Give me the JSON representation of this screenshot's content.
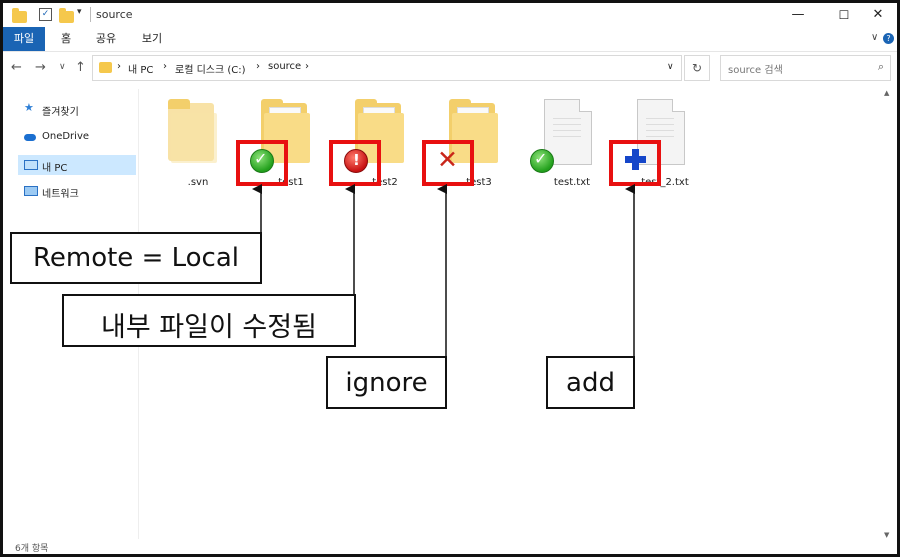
{
  "window": {
    "title": "source",
    "controls": {
      "minimize": "—",
      "maximize": "☐",
      "close": "✕"
    },
    "quick_access_icons": [
      "folder-icon",
      "checkbox-icon",
      "folder-icon",
      "dropdown-arrow-icon"
    ]
  },
  "ribbon": {
    "tabs": [
      {
        "label": "파일",
        "active": true
      },
      {
        "label": "홈",
        "active": false
      },
      {
        "label": "공유",
        "active": false
      },
      {
        "label": "보기",
        "active": false
      }
    ],
    "collapse_glyph": "∨",
    "help_glyph": "?"
  },
  "navigation": {
    "back": "←",
    "forward": "→",
    "recent": "∨",
    "up": "↑",
    "breadcrumb": [
      "내 PC",
      "로컬 디스크 (C:)",
      "source"
    ],
    "separator": "›",
    "dropdown": "∨",
    "refresh": "↻",
    "search_placeholder": "source 검색",
    "search_glyph": "⌕"
  },
  "sidebar": {
    "items": [
      {
        "label": "즐겨찾기",
        "icon": "star-icon",
        "selected": false
      },
      {
        "label": "OneDrive",
        "icon": "cloud-icon",
        "selected": false
      },
      {
        "label": "내 PC",
        "icon": "computer-icon",
        "selected": true
      },
      {
        "label": "네트워크",
        "icon": "network-icon",
        "selected": false
      }
    ]
  },
  "files": [
    {
      "name": ".svn",
      "type": "folder",
      "overlay": "none"
    },
    {
      "name": "test1",
      "type": "folder",
      "overlay": "normal"
    },
    {
      "name": "test2",
      "type": "folder",
      "overlay": "modified"
    },
    {
      "name": "test3",
      "type": "folder",
      "overlay": "ignored"
    },
    {
      "name": "test.txt",
      "type": "file",
      "overlay": "normal"
    },
    {
      "name": "test_2.txt",
      "type": "file",
      "overlay": "added"
    }
  ],
  "overlay_glyphs": {
    "normal": "✓",
    "modified": "!",
    "ignored": "✕"
  },
  "annotations": [
    {
      "text": "Remote = Local",
      "target": "test1"
    },
    {
      "text": "내부 파일이 수정됨",
      "target": "test2"
    },
    {
      "text": "ignore",
      "target": "test3"
    },
    {
      "text": "add",
      "target": "test_2.txt"
    }
  ],
  "status_bar": {
    "item_count": "6개 항목"
  },
  "colors": {
    "ribbon_active": "#1a64b4",
    "highlight_red": "#e81010",
    "sidebar_selected": "#cce8ff",
    "overlay_ok": "#22a01c",
    "overlay_modified": "#c81212",
    "overlay_ignored": "#c9261a",
    "overlay_added": "#1546c9"
  }
}
